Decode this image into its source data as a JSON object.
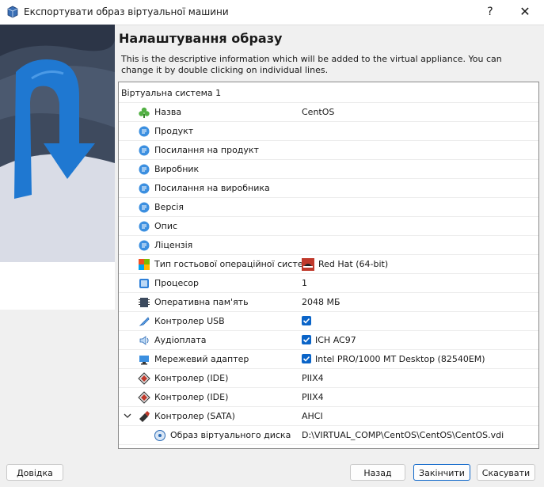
{
  "window": {
    "title": "Експортувати образ віртуальної машини",
    "help_glyph": "?",
    "close_glyph": "✕"
  },
  "page": {
    "heading": "Налаштування образу",
    "description": "This is the descriptive information which will be added to the virtual appliance. You can change it by double clicking on individual lines."
  },
  "tree": {
    "root": "Віртуальна система 1",
    "rows": [
      {
        "label": "Назва",
        "value": "CentOS",
        "icon": "name-icon"
      },
      {
        "label": "Продукт",
        "value": "",
        "icon": "description-icon"
      },
      {
        "label": "Посилання на продукт",
        "value": "",
        "icon": "description-icon"
      },
      {
        "label": "Виробник",
        "value": "",
        "icon": "description-icon"
      },
      {
        "label": "Посилання на виробника",
        "value": "",
        "icon": "description-icon"
      },
      {
        "label": "Версія",
        "value": "",
        "icon": "description-icon"
      },
      {
        "label": "Опис",
        "value": "",
        "icon": "description-icon"
      },
      {
        "label": "Ліцензія",
        "value": "",
        "icon": "description-icon"
      },
      {
        "label": "Тип гостьової операційної системи",
        "value": "Red Hat (64-bit)",
        "icon": "os-type-icon"
      },
      {
        "label": "Процесор",
        "value": "1",
        "icon": "cpu-icon"
      },
      {
        "label": "Оперативна пам'ять",
        "value": "2048 МБ",
        "icon": "ram-icon"
      },
      {
        "label": "Контролер USB",
        "value": "",
        "checked": true,
        "icon": "usb-icon"
      },
      {
        "label": "Аудіоплата",
        "value": "ICH AC97",
        "checked": true,
        "icon": "audio-icon"
      },
      {
        "label": "Мережевий адаптер",
        "value": "Intel PRO/1000 MT Desktop (82540EM)",
        "checked": true,
        "icon": "network-icon"
      },
      {
        "label": "Контролер (IDE)",
        "value": "PIIX4",
        "icon": "ide-controller-icon"
      },
      {
        "label": "Контролер (IDE)",
        "value": "PIIX4",
        "icon": "ide-controller-icon"
      },
      {
        "label": "Контролер (SATA)",
        "value": "AHCI",
        "icon": "sata-controller-icon"
      },
      {
        "label": "Образ віртуального диска",
        "value": "D:\\VIRTUAL_COMP\\CentOS\\CentOS\\CentOS.vdi",
        "icon": "disk-image-icon"
      }
    ]
  },
  "buttons": {
    "help": "Довідка",
    "back": "Назад",
    "finish": "Закінчити",
    "cancel": "Скасувати"
  }
}
